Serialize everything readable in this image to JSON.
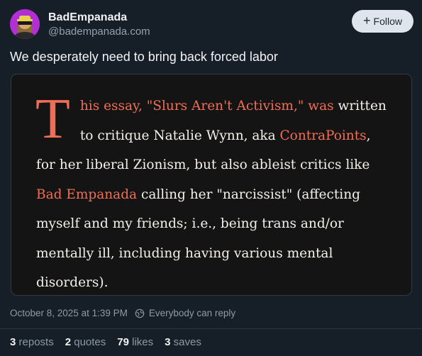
{
  "author": {
    "display_name": "BadEmpanada",
    "handle": "@badempanada.com"
  },
  "follow_button": {
    "label": "Follow"
  },
  "post": {
    "text": "We desperately need to bring back forced labor"
  },
  "embed": {
    "dropcap": "T",
    "segments": [
      {
        "text": "his essay, \"Slurs Aren't Activism,\" was",
        "highlight": true
      },
      {
        "text": " written to critique Natalie Wynn, aka ",
        "highlight": false
      },
      {
        "text": "ContraPoints",
        "highlight": true
      },
      {
        "text": ", for her liberal Zionism, but also ableist critics like ",
        "highlight": false
      },
      {
        "text": "Bad Empanada",
        "highlight": true
      },
      {
        "text": " calling her \"narcissist\" (affecting myself and my friends; i.e., being trans and/or mentally ill, including having various mental disorders).",
        "highlight": false
      }
    ]
  },
  "meta": {
    "timestamp": "October 8, 2025 at 1:39 PM",
    "reply_setting": "Everybody can reply"
  },
  "stats": {
    "reposts": {
      "count": "3",
      "label": "reposts"
    },
    "quotes": {
      "count": "2",
      "label": "quotes"
    },
    "likes": {
      "count": "79",
      "label": "likes"
    },
    "saves": {
      "count": "3",
      "label": "saves"
    }
  },
  "colors": {
    "background": "#161e27",
    "accent": "#f06e55",
    "avatar_bg": "#b22fd6"
  }
}
